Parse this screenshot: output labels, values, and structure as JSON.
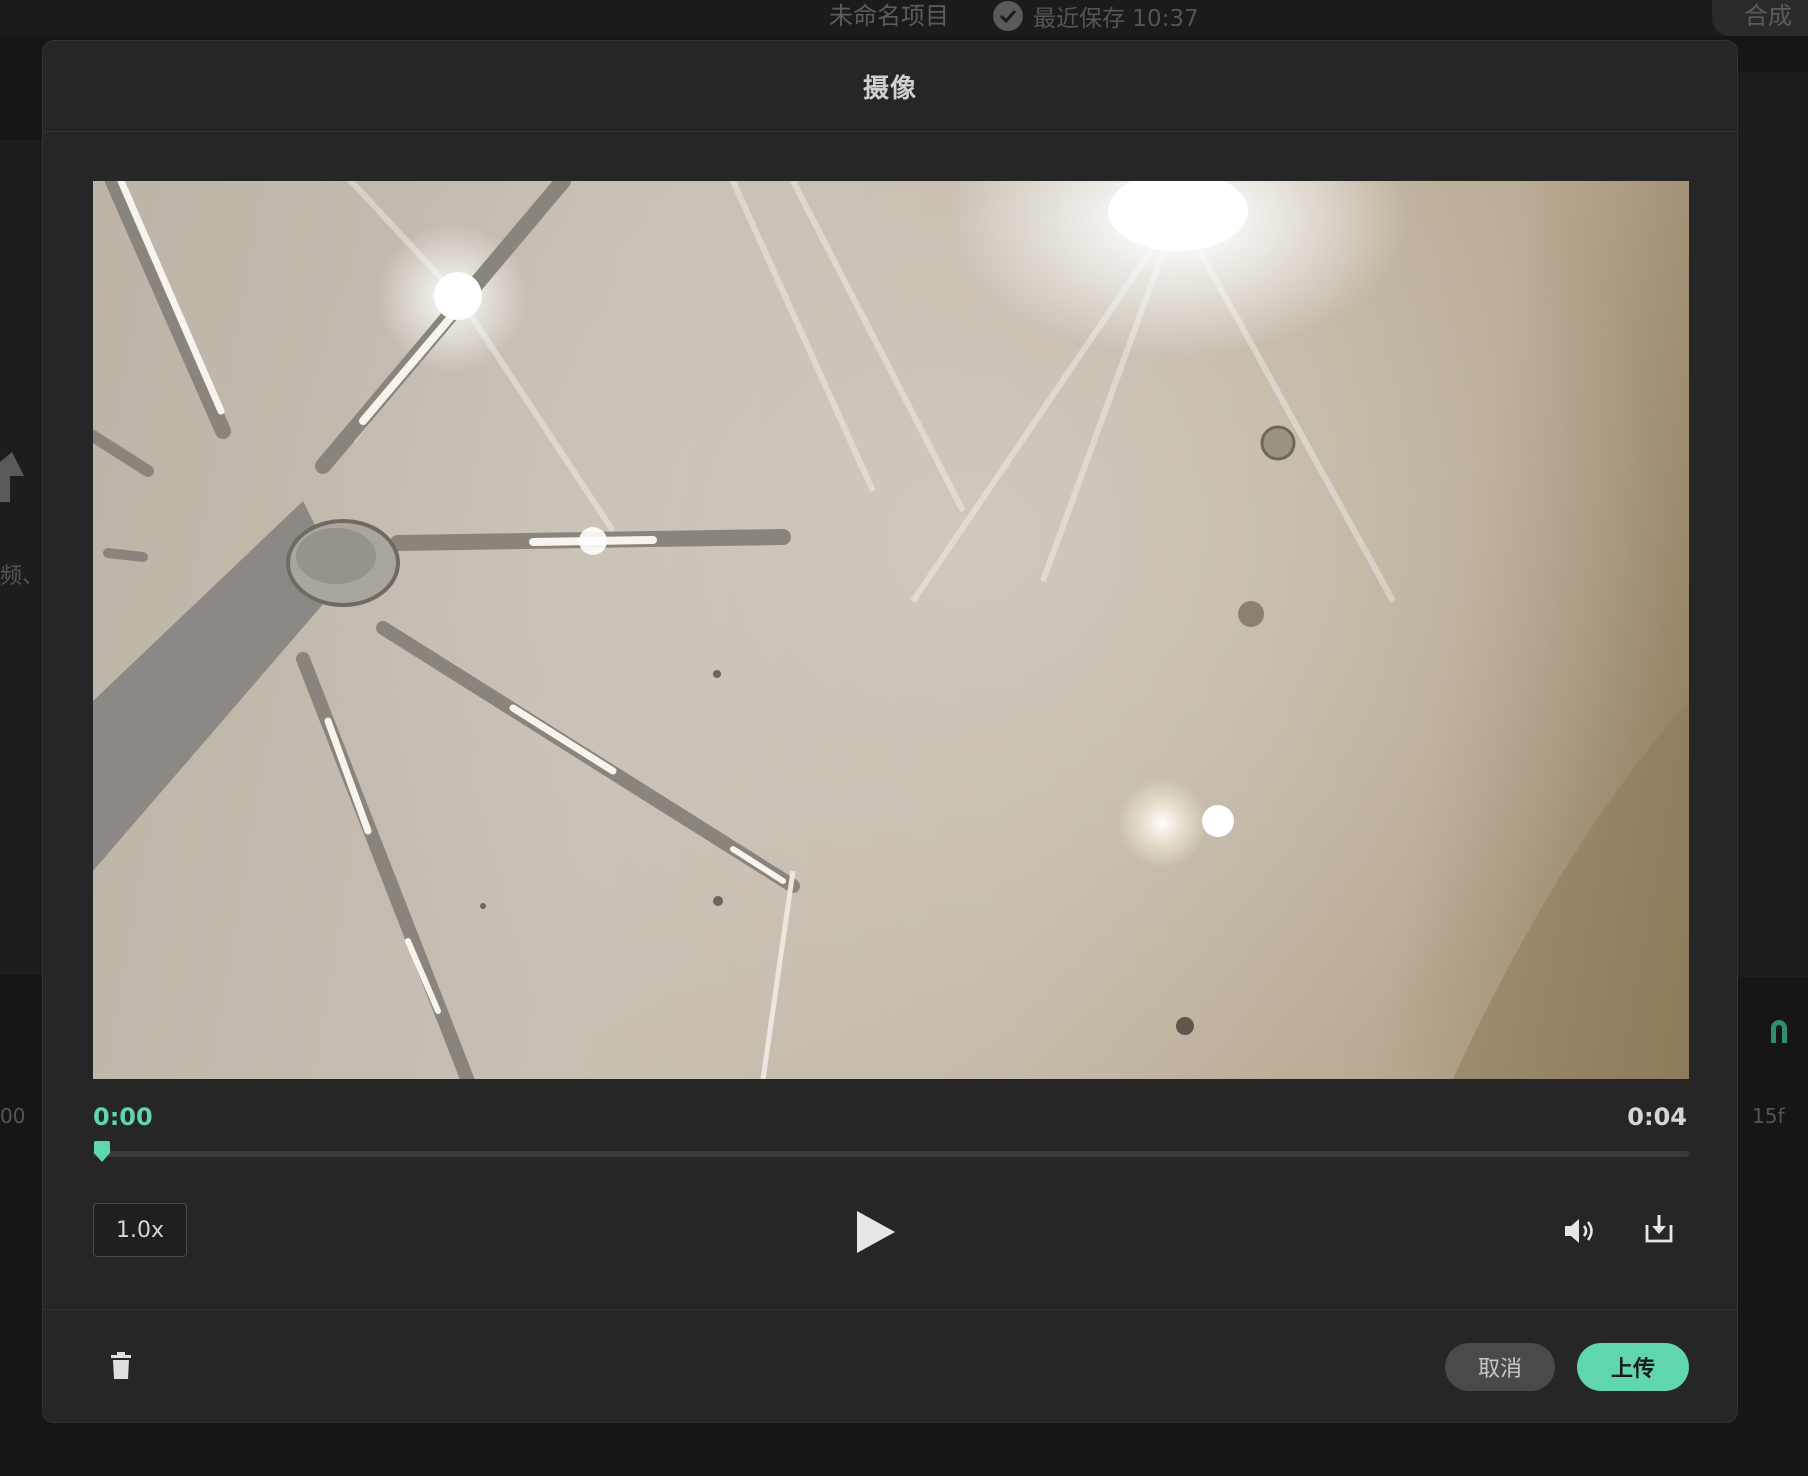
{
  "background": {
    "project_title": "未命名项目",
    "save_status": "最近保存 10:37",
    "compose_label": "合成",
    "side_fragment": "频、",
    "left_ruler_value": "00",
    "right_frame_label": "15f"
  },
  "modal": {
    "title": "摄像",
    "current_time": "0:00",
    "duration": "0:04",
    "progress": 0,
    "speed_label": "1.0x",
    "cancel_label": "取消",
    "upload_label": "上传"
  },
  "icons": {
    "check": "check-circle-icon",
    "upload": "upload-arrow-icon",
    "magnet": "magnet-icon",
    "play": "play-icon",
    "volume": "volume-icon",
    "download": "download-icon",
    "trash": "trash-icon"
  },
  "colors": {
    "accent": "#5fd6ad",
    "modal_bg": "#262626",
    "page_bg": "#161616"
  }
}
